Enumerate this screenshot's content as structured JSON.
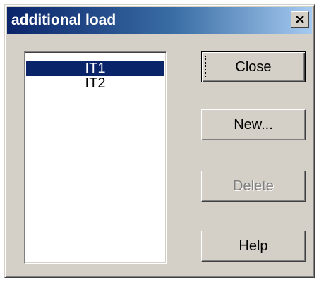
{
  "window": {
    "title": "additional load"
  },
  "list": {
    "items": [
      {
        "label": "IT1",
        "selected": true
      },
      {
        "label": "IT2",
        "selected": false
      }
    ]
  },
  "buttons": {
    "close": "Close",
    "new": "New...",
    "delete": "Delete",
    "help": "Help"
  },
  "colors": {
    "dialog_face": "#d4d0c8",
    "title_gradient_start": "#0a246a",
    "title_gradient_end": "#a6caf0",
    "selection": "#0a246a",
    "disabled_text": "#808080"
  },
  "icons": {
    "title_close": "close-x-icon"
  }
}
